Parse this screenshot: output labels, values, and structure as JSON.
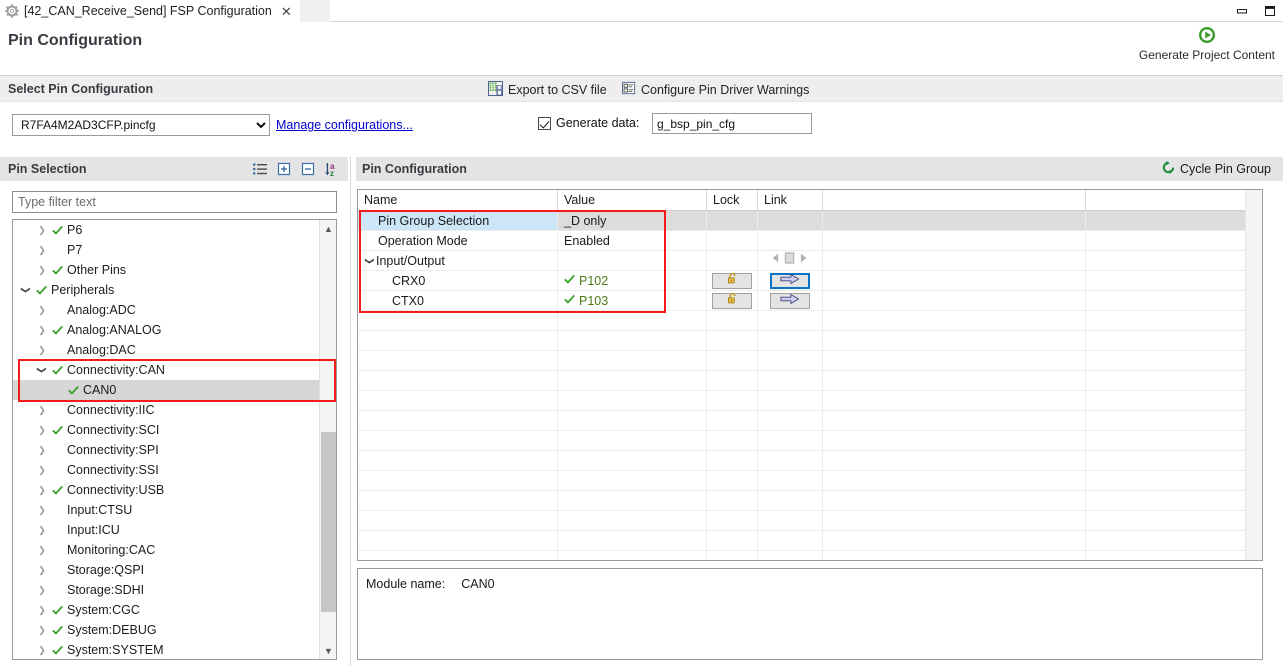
{
  "window": {
    "tab_title": "[42_CAN_Receive_Send] FSP Configuration",
    "tab_icon": "gear-icon",
    "close_icon": "close-icon",
    "minimize_icon": "minimize-icon",
    "maximize_icon": "maximize-icon"
  },
  "header": {
    "page_title": "Pin Configuration",
    "generate_button": {
      "label": "Generate Project Content",
      "icon": "play-circle-icon",
      "color": "#3a9a28"
    }
  },
  "select_band": {
    "title": "Select Pin Configuration",
    "tools": [
      {
        "label": "Export to CSV file",
        "icon": "save-csv-icon"
      },
      {
        "label": "Configure Pin Driver Warnings",
        "icon": "checklist-icon"
      }
    ],
    "config_select": {
      "value": "R7FA4M2AD3CFP.pincfg",
      "options": [
        "R7FA4M2AD3CFP.pincfg"
      ]
    },
    "manage_link": "Manage configurations...",
    "generate_data": {
      "label": "Generate data:",
      "checked": true,
      "value": "g_bsp_pin_cfg"
    }
  },
  "pin_selection": {
    "title": "Pin Selection",
    "tools": [
      {
        "name": "show-list-icon",
        "label": "Show list"
      },
      {
        "name": "expand-all-icon",
        "label": "Expand all"
      },
      {
        "name": "collapse-all-icon",
        "label": "Collapse all"
      },
      {
        "name": "sort-alpha-icon",
        "label": "Sort alphabetically"
      }
    ],
    "filter_placeholder": "Type filter text",
    "filter_value": "",
    "tree": [
      {
        "label": "P6",
        "indent": 1,
        "twisty": "collapsed",
        "check": true,
        "selected": false
      },
      {
        "label": "P7",
        "indent": 1,
        "twisty": "collapsed",
        "check": false,
        "selected": false
      },
      {
        "label": "Other Pins",
        "indent": 1,
        "twisty": "collapsed",
        "check": true,
        "selected": false
      },
      {
        "label": "Peripherals",
        "indent": 0,
        "twisty": "expanded",
        "check": true,
        "selected": false
      },
      {
        "label": "Analog:ADC",
        "indent": 1,
        "twisty": "collapsed",
        "check": false,
        "selected": false
      },
      {
        "label": "Analog:ANALOG",
        "indent": 1,
        "twisty": "collapsed",
        "check": true,
        "selected": false
      },
      {
        "label": "Analog:DAC",
        "indent": 1,
        "twisty": "collapsed",
        "check": false,
        "selected": false
      },
      {
        "label": "Connectivity:CAN",
        "indent": 1,
        "twisty": "expanded",
        "check": true,
        "selected": false
      },
      {
        "label": "CAN0",
        "indent": 2,
        "twisty": "none",
        "check": true,
        "selected": true
      },
      {
        "label": "Connectivity:IIC",
        "indent": 1,
        "twisty": "collapsed",
        "check": false,
        "selected": false
      },
      {
        "label": "Connectivity:SCI",
        "indent": 1,
        "twisty": "collapsed",
        "check": true,
        "selected": false
      },
      {
        "label": "Connectivity:SPI",
        "indent": 1,
        "twisty": "collapsed",
        "check": false,
        "selected": false
      },
      {
        "label": "Connectivity:SSI",
        "indent": 1,
        "twisty": "collapsed",
        "check": false,
        "selected": false
      },
      {
        "label": "Connectivity:USB",
        "indent": 1,
        "twisty": "collapsed",
        "check": true,
        "selected": false
      },
      {
        "label": "Input:CTSU",
        "indent": 1,
        "twisty": "collapsed",
        "check": false,
        "selected": false
      },
      {
        "label": "Input:ICU",
        "indent": 1,
        "twisty": "collapsed",
        "check": false,
        "selected": false
      },
      {
        "label": "Monitoring:CAC",
        "indent": 1,
        "twisty": "collapsed",
        "check": false,
        "selected": false
      },
      {
        "label": "Storage:QSPI",
        "indent": 1,
        "twisty": "collapsed",
        "check": false,
        "selected": false
      },
      {
        "label": "Storage:SDHI",
        "indent": 1,
        "twisty": "collapsed",
        "check": false,
        "selected": false
      },
      {
        "label": "System:CGC",
        "indent": 1,
        "twisty": "collapsed",
        "check": true,
        "selected": false
      },
      {
        "label": "System:DEBUG",
        "indent": 1,
        "twisty": "collapsed",
        "check": true,
        "selected": false
      },
      {
        "label": "System:SYSTEM",
        "indent": 1,
        "twisty": "collapsed",
        "check": true,
        "selected": false
      }
    ]
  },
  "pin_configuration": {
    "title": "Pin Configuration",
    "cycle_link": {
      "label": "Cycle Pin Group",
      "icon": "refresh-cycle-icon"
    },
    "columns": [
      "Name",
      "Value",
      "Lock",
      "Link",
      "",
      ""
    ],
    "rows": [
      {
        "name": "Pin Group Selection",
        "value": "_D only",
        "indent": 1,
        "twisty": "none",
        "shaded": true,
        "name_highlight": true,
        "lock": "none",
        "link": "none",
        "value_check": false
      },
      {
        "name": "Operation Mode",
        "value": "Enabled",
        "indent": 1,
        "twisty": "none",
        "shaded": false,
        "name_highlight": false,
        "lock": "none",
        "link": "none",
        "value_check": false
      },
      {
        "name": "Input/Output",
        "value": "",
        "indent": 0,
        "twisty": "expanded",
        "shaded": false,
        "name_highlight": false,
        "lock": "none",
        "link": "nav",
        "value_check": false
      },
      {
        "name": "CRX0",
        "value": "P102",
        "indent": 2,
        "twisty": "none",
        "shaded": false,
        "name_highlight": false,
        "lock": "unlocked",
        "link": "arrow-focused",
        "value_check": true
      },
      {
        "name": "CTX0",
        "value": "P103",
        "indent": 2,
        "twisty": "none",
        "shaded": false,
        "name_highlight": false,
        "lock": "unlocked",
        "link": "arrow",
        "value_check": true
      }
    ],
    "empty_row_count": 13
  },
  "module_panel": {
    "label": "Module name:",
    "value": "CAN0"
  },
  "annotations": {
    "highlight_color": "#f41b1b",
    "boxes": [
      {
        "name": "tree-can-highlight"
      },
      {
        "name": "table-rows-highlight"
      }
    ]
  }
}
